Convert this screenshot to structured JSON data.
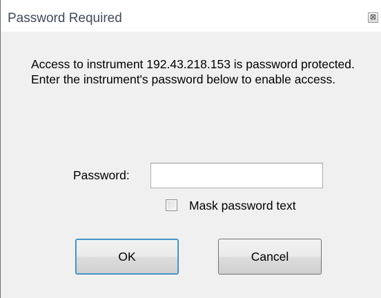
{
  "window": {
    "title": "Password Required",
    "close_glyph": "⊠"
  },
  "message": {
    "text": "Access to instrument 192.43.218.153 is password protected.  Enter the instrument's password below to enable access."
  },
  "password": {
    "label": "Password:",
    "value": "",
    "placeholder": ""
  },
  "mask": {
    "label": "Mask password text",
    "checked": false
  },
  "buttons": {
    "ok_label": "OK",
    "cancel_label": "Cancel"
  },
  "colors": {
    "title_text": "#404a5a",
    "default_button_border": "#3c7fb1"
  }
}
